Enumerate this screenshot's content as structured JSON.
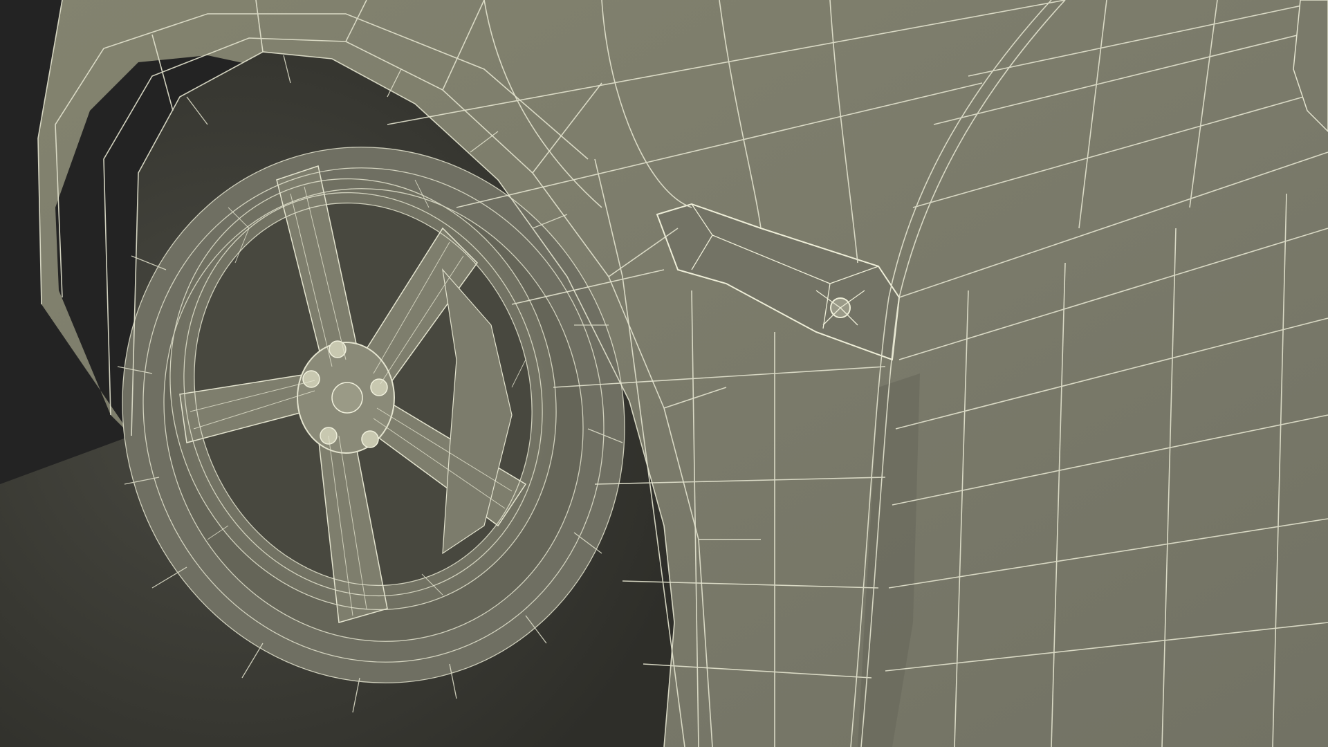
{
  "scene": {
    "subject": "car-front-wheel-wireframe",
    "colors": {
      "background": "#232323",
      "body": "#7c7c6c",
      "body_dark": "#68685b",
      "body_shadow": "#4e4e44",
      "wheel_well": "#3a3a33",
      "tire": "#6f6f62",
      "wire": "#e4e4cf"
    }
  }
}
